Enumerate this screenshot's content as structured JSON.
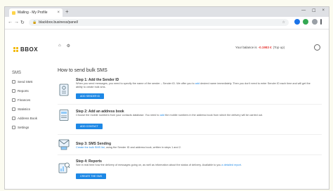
{
  "browser": {
    "tab_title": "Mailing - My Profile",
    "new_tab_glyph": "+",
    "close_glyph": "×",
    "url": "blackbox.business/panel/",
    "back_glyph": "←",
    "forward_glyph": "→",
    "reload_glyph": "↻",
    "star_glyph": "☆",
    "window_minimize": "—",
    "window_maximize": "☐",
    "window_close": "×"
  },
  "header": {
    "logo_text": "BBOX",
    "home_glyph": "⌂",
    "menu_glyph": "⚙",
    "balance_label": "Your balance is",
    "balance_amount": "-0.1983 €",
    "topup_label": "(Top up)",
    "profile_icon": "power-icon"
  },
  "sidebar": {
    "heading": "SMS",
    "items": [
      {
        "label": "Send SMS",
        "icon": "send-icon"
      },
      {
        "label": "Reports",
        "icon": "report-icon"
      },
      {
        "label": "Finances",
        "icon": "finance-icon"
      },
      {
        "label": "Statistics",
        "icon": "stats-icon"
      },
      {
        "label": "Address Book",
        "icon": "book-icon"
      },
      {
        "label": "Settings",
        "icon": "gear-icon"
      }
    ]
  },
  "main": {
    "title": "How to send bulk SMS",
    "steps": [
      {
        "title": "Step 1: Add the Sender ID",
        "desc_before": "When you send messages, you need to specify the name of the sender – Sender ID. We offer you to ",
        "desc_link": "add",
        "desc_after": " desired name immediately. Then you don't need to enter Sender ID each time and will get the ability to create bulk sms.",
        "button": "ADD SENDER ID"
      },
      {
        "title": "Step 2: Add an address book",
        "desc_before": "Choose the mobile numbers from your contacts database. You need to ",
        "desc_link": "add",
        "desc_after": " the mobile numbers in the address book from which the delivery will be carried out.",
        "button": "ADD CONTACT"
      },
      {
        "title": "Step 3: SMS Sending",
        "desc_before": "",
        "desc_link": "Create the bulk SMS list",
        "desc_after": ", using the Sender ID and address book, written in steps 1 and 2.",
        "button": ""
      },
      {
        "title": "Step 4: Reports",
        "desc_before": "See in real time how the delivery of messages going on, as well as information about the status of delivery. Available to you ",
        "desc_link": "a detailed report",
        "desc_after": ".",
        "button": "CREATE THE SMS"
      }
    ]
  },
  "colors": {
    "accent": "#1e88e5",
    "brand_yellow": "#f2b600",
    "balance_red": "#e53935"
  }
}
